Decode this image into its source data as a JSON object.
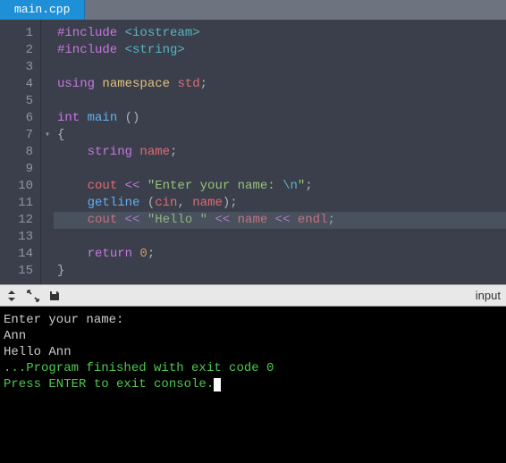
{
  "tab": {
    "filename": "main.cpp"
  },
  "editor": {
    "highlighted_line_index": 11,
    "gutter": [
      "1",
      "2",
      "3",
      "4",
      "5",
      "6",
      "7",
      "8",
      "9",
      "10",
      "11",
      "12",
      "13",
      "14",
      "15"
    ],
    "fold_markers": {
      "6": "▾"
    },
    "lines": [
      [
        {
          "t": "#include ",
          "c": "tok-pre"
        },
        {
          "t": "<iostream>",
          "c": "tok-inc"
        }
      ],
      [
        {
          "t": "#include ",
          "c": "tok-pre"
        },
        {
          "t": "<string>",
          "c": "tok-inc"
        }
      ],
      [
        {
          "t": "",
          "c": "tok-pn"
        }
      ],
      [
        {
          "t": "using ",
          "c": "tok-kw"
        },
        {
          "t": "namespace ",
          "c": "tok-ns"
        },
        {
          "t": "std",
          "c": "tok-id"
        },
        {
          "t": ";",
          "c": "tok-pn"
        }
      ],
      [
        {
          "t": "",
          "c": "tok-pn"
        }
      ],
      [
        {
          "t": "int ",
          "c": "tok-kw"
        },
        {
          "t": "main ",
          "c": "tok-fn"
        },
        {
          "t": "()",
          "c": "tok-pn"
        }
      ],
      [
        {
          "t": "{",
          "c": "tok-pn"
        }
      ],
      [
        {
          "t": "    string ",
          "c": "tok-kw"
        },
        {
          "t": "name",
          "c": "tok-id"
        },
        {
          "t": ";",
          "c": "tok-pn"
        }
      ],
      [
        {
          "t": "",
          "c": "tok-pn"
        }
      ],
      [
        {
          "t": "    ",
          "c": "tok-pn"
        },
        {
          "t": "cout",
          "c": "tok-cout"
        },
        {
          "t": " << ",
          "c": "tok-op"
        },
        {
          "t": "\"Enter your name: ",
          "c": "tok-str"
        },
        {
          "t": "\\n",
          "c": "tok-esc"
        },
        {
          "t": "\"",
          "c": "tok-str"
        },
        {
          "t": ";",
          "c": "tok-pn"
        }
      ],
      [
        {
          "t": "    ",
          "c": "tok-pn"
        },
        {
          "t": "getline ",
          "c": "tok-fn"
        },
        {
          "t": "(",
          "c": "tok-pn"
        },
        {
          "t": "cin",
          "c": "tok-id"
        },
        {
          "t": ", ",
          "c": "tok-pn"
        },
        {
          "t": "name",
          "c": "tok-id"
        },
        {
          "t": ")",
          "c": "tok-pn"
        },
        {
          "t": ";",
          "c": "tok-pn"
        }
      ],
      [
        {
          "t": "    ",
          "c": "tok-pn"
        },
        {
          "t": "cout",
          "c": "tok-cout"
        },
        {
          "t": " << ",
          "c": "tok-op"
        },
        {
          "t": "\"Hello \"",
          "c": "tok-str"
        },
        {
          "t": " << ",
          "c": "tok-op"
        },
        {
          "t": "name",
          "c": "tok-id"
        },
        {
          "t": " << ",
          "c": "tok-op"
        },
        {
          "t": "endl",
          "c": "tok-endl"
        },
        {
          "t": ";",
          "c": "tok-pn"
        }
      ],
      [
        {
          "t": "",
          "c": "tok-pn"
        }
      ],
      [
        {
          "t": "    ",
          "c": "tok-pn"
        },
        {
          "t": "return ",
          "c": "tok-kw"
        },
        {
          "t": "0",
          "c": "tok-num"
        },
        {
          "t": ";",
          "c": "tok-pn"
        }
      ],
      [
        {
          "t": "}",
          "c": "tok-pn"
        }
      ]
    ]
  },
  "toolbar": {
    "right_label": "input"
  },
  "console": {
    "lines": [
      {
        "text": "Enter your name:",
        "c": ""
      },
      {
        "text": "Ann",
        "c": ""
      },
      {
        "text": "Hello Ann",
        "c": ""
      },
      {
        "text": "",
        "c": ""
      },
      {
        "text": "",
        "c": ""
      },
      {
        "text": "...Program finished with exit code 0",
        "c": "cons-green"
      },
      {
        "text": "Press ENTER to exit console.",
        "c": "cons-green",
        "cursor": true
      }
    ]
  }
}
